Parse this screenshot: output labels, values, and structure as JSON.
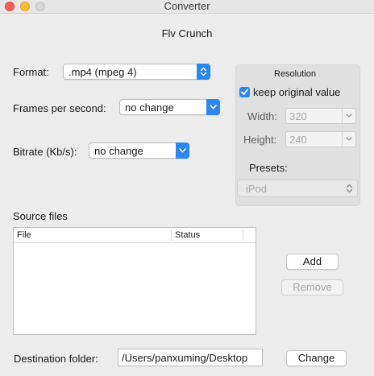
{
  "window": {
    "title": "Converter"
  },
  "app_title": "Flv Crunch",
  "format": {
    "label": "Format:",
    "value": ".mp4 (mpeg 4)"
  },
  "fps": {
    "label": "Frames per second:",
    "value": "no change"
  },
  "bitrate": {
    "label": "Bitrate (Kb/s):",
    "value": "no change"
  },
  "resolution": {
    "title": "Resolution",
    "keep_original": {
      "label": "keep original value",
      "checked": true
    },
    "width": {
      "label": "Width:",
      "value": "320"
    },
    "height": {
      "label": "Height:",
      "value": "240"
    },
    "presets_label": "Presets:",
    "preset_value": "iPod"
  },
  "source_files": {
    "label": "Source files",
    "columns": [
      "File",
      "Status"
    ],
    "rows": []
  },
  "buttons": {
    "add": "Add",
    "remove": "Remove",
    "change": "Change"
  },
  "destination": {
    "label": "Destination folder:",
    "value": "/Users/panxuming/Desktop"
  },
  "colors": {
    "accent": "#2a86f6",
    "window_bg": "#ececec"
  }
}
